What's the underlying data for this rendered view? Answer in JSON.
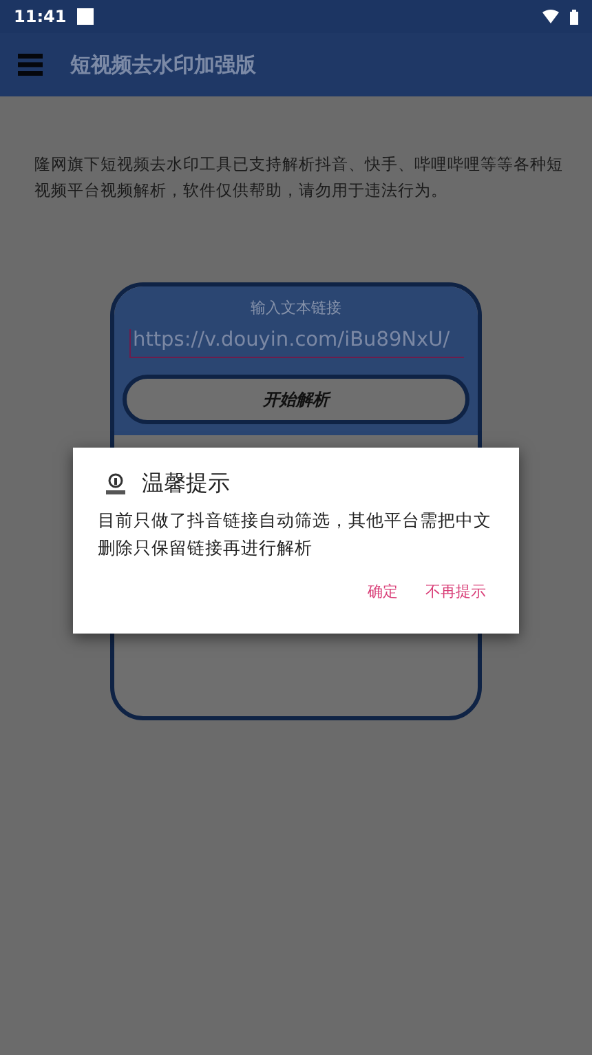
{
  "status_bar": {
    "time": "11:41"
  },
  "app_bar": {
    "title": "短视频去水印加强版"
  },
  "intro": "隆网旗下短视频去水印工具已支持解析抖音、快手、哔哩哔哩等等各种短视频平台视频解析，软件仅供帮助，请勿用于违法行为。",
  "card": {
    "input_label": "输入文本链接",
    "input_value": "https://v.douyin.com/iBu89NxU/",
    "button": "开始解析"
  },
  "dialog": {
    "title": "温馨提示",
    "message": "目前只做了抖音链接自动筛选，其他平台需把中文删除只保留链接再进行解析",
    "buttons": [
      "确定",
      "不再提示"
    ]
  }
}
